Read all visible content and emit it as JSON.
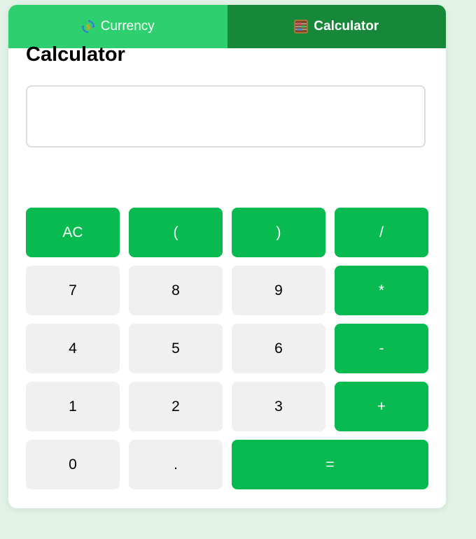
{
  "tabs": [
    {
      "label": "Currency",
      "icon": "currency-exchange-icon",
      "active": false
    },
    {
      "label": "Calculator",
      "icon": "abacus-icon",
      "active": true
    }
  ],
  "title": "Calculator",
  "display": {
    "value": ""
  },
  "keys": [
    {
      "label": "AC",
      "name": "clear-button",
      "style": "green"
    },
    {
      "label": "(",
      "name": "open-paren-button",
      "style": "green"
    },
    {
      "label": ")",
      "name": "close-paren-button",
      "style": "green"
    },
    {
      "label": "/",
      "name": "divide-button",
      "style": "green"
    },
    {
      "label": "7",
      "name": "digit-7-button",
      "style": "gray"
    },
    {
      "label": "8",
      "name": "digit-8-button",
      "style": "gray"
    },
    {
      "label": "9",
      "name": "digit-9-button",
      "style": "gray"
    },
    {
      "label": "*",
      "name": "multiply-button",
      "style": "green"
    },
    {
      "label": "4",
      "name": "digit-4-button",
      "style": "gray"
    },
    {
      "label": "5",
      "name": "digit-5-button",
      "style": "gray"
    },
    {
      "label": "6",
      "name": "digit-6-button",
      "style": "gray"
    },
    {
      "label": "-",
      "name": "subtract-button",
      "style": "green"
    },
    {
      "label": "1",
      "name": "digit-1-button",
      "style": "gray"
    },
    {
      "label": "2",
      "name": "digit-2-button",
      "style": "gray"
    },
    {
      "label": "3",
      "name": "digit-3-button",
      "style": "gray"
    },
    {
      "label": "+",
      "name": "add-button",
      "style": "green"
    },
    {
      "label": "0",
      "name": "digit-0-button",
      "style": "gray"
    },
    {
      "label": ".",
      "name": "decimal-button",
      "style": "gray"
    },
    {
      "label": "=",
      "name": "equals-button",
      "style": "green",
      "wide": true
    }
  ],
  "colors": {
    "page_background": "#e2f2e6",
    "tab_inactive": "#2ecf6f",
    "tab_active": "#17873a",
    "key_accent": "#08ba50",
    "key_neutral": "#f0f0f0"
  }
}
